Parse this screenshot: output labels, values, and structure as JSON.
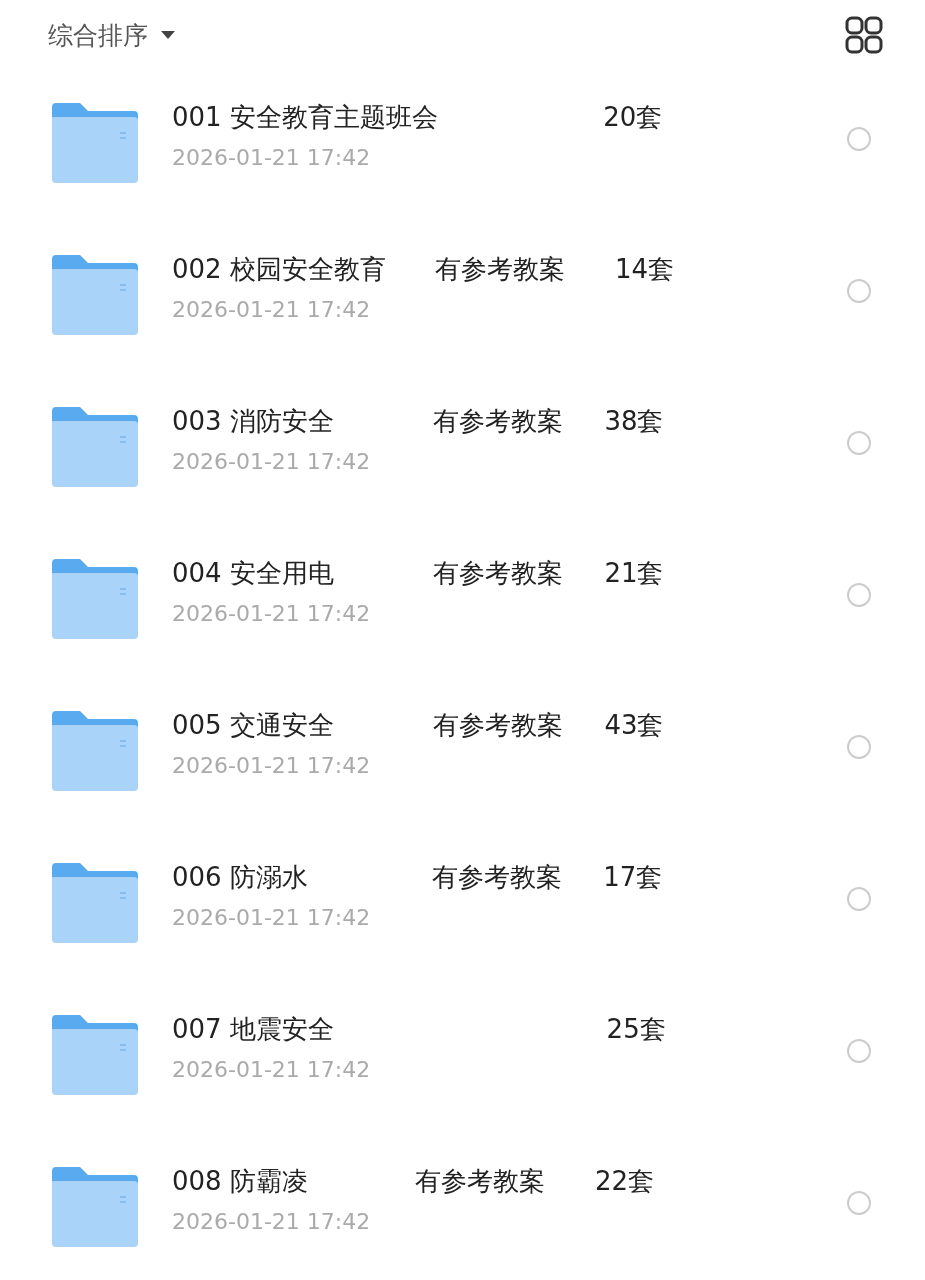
{
  "toolbar": {
    "sort_label": "综合排序"
  },
  "files": [
    {
      "name": "001 安全教育主题班会                    20套",
      "date": "2026-01-21 17:42",
      "selected": false
    },
    {
      "name": "002 校园安全教育      有参考教案      14套",
      "date": "2026-01-21 17:42",
      "selected": false
    },
    {
      "name": "003 消防安全            有参考教案     38套",
      "date": "2026-01-21 17:42",
      "selected": false
    },
    {
      "name": "004 安全用电            有参考教案     21套",
      "date": "2026-01-21 17:42",
      "selected": false
    },
    {
      "name": "005 交通安全            有参考教案     43套",
      "date": "2026-01-21 17:42",
      "selected": false
    },
    {
      "name": "006 防溺水               有参考教案     17套",
      "date": "2026-01-21 17:42",
      "selected": false
    },
    {
      "name": "007 地震安全                                 25套",
      "date": "2026-01-21 17:42",
      "selected": false
    },
    {
      "name": "008 防霸凌             有参考教案      22套",
      "date": "2026-01-21 17:42",
      "selected": false
    }
  ]
}
